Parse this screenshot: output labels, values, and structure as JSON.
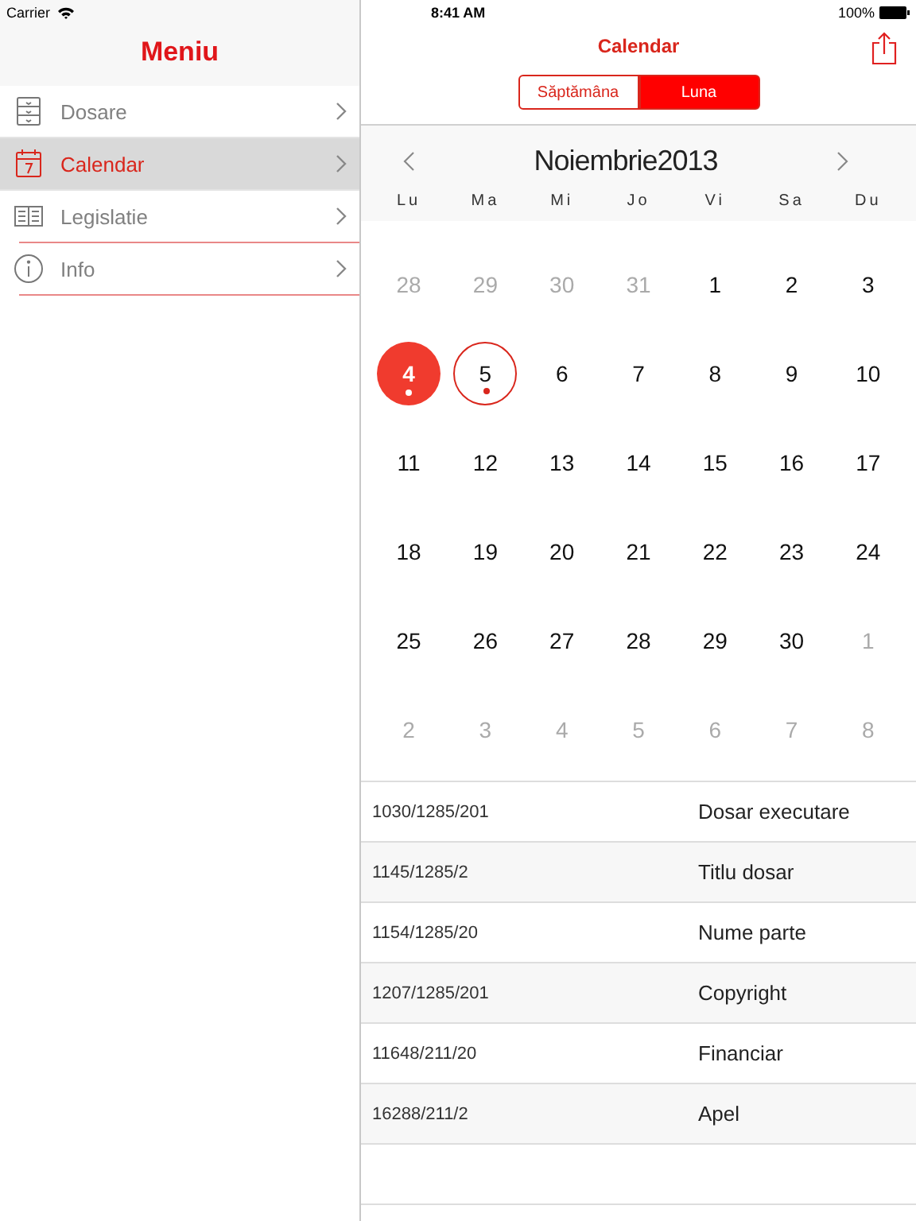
{
  "status_bar": {
    "carrier": "Carrier",
    "time": "8:41 AM",
    "battery": "100%"
  },
  "sidebar": {
    "title": "Meniu",
    "items": [
      {
        "kind": "drawers",
        "label": "Dosare",
        "selected": false,
        "underlined": false
      },
      {
        "kind": "calendar",
        "label": "Calendar",
        "selected": true,
        "underlined": false
      },
      {
        "kind": "book",
        "label": "Legislatie",
        "selected": false,
        "underlined": true
      },
      {
        "kind": "info",
        "label": "Info",
        "selected": false,
        "underlined": true
      }
    ]
  },
  "header": {
    "title": "Calendar",
    "segments": [
      {
        "label": "Săptămâna",
        "selected": false
      },
      {
        "label": "Luna",
        "selected": true
      }
    ]
  },
  "calendar": {
    "month": "Noiembrie",
    "year": "2013",
    "weekdays": [
      "Lu",
      "Ma",
      "Mi",
      "Jo",
      "Vi",
      "Sa",
      "Du"
    ],
    "weeks": [
      [
        {
          "day": "28",
          "in_month": false,
          "selected": false,
          "today": false,
          "event": false
        },
        {
          "day": "29",
          "in_month": false,
          "selected": false,
          "today": false,
          "event": false
        },
        {
          "day": "30",
          "in_month": false,
          "selected": false,
          "today": false,
          "event": false
        },
        {
          "day": "31",
          "in_month": false,
          "selected": false,
          "today": false,
          "event": false
        },
        {
          "day": "1",
          "in_month": true,
          "selected": false,
          "today": false,
          "event": false
        },
        {
          "day": "2",
          "in_month": true,
          "selected": false,
          "today": false,
          "event": false
        },
        {
          "day": "3",
          "in_month": true,
          "selected": false,
          "today": false,
          "event": false
        }
      ],
      [
        {
          "day": "4",
          "in_month": true,
          "selected": true,
          "today": false,
          "event": true
        },
        {
          "day": "5",
          "in_month": true,
          "selected": false,
          "today": true,
          "event": true
        },
        {
          "day": "6",
          "in_month": true,
          "selected": false,
          "today": false,
          "event": false
        },
        {
          "day": "7",
          "in_month": true,
          "selected": false,
          "today": false,
          "event": false
        },
        {
          "day": "8",
          "in_month": true,
          "selected": false,
          "today": false,
          "event": false
        },
        {
          "day": "9",
          "in_month": true,
          "selected": false,
          "today": false,
          "event": false
        },
        {
          "day": "10",
          "in_month": true,
          "selected": false,
          "today": false,
          "event": false
        }
      ],
      [
        {
          "day": "11",
          "in_month": true,
          "selected": false,
          "today": false,
          "event": false
        },
        {
          "day": "12",
          "in_month": true,
          "selected": false,
          "today": false,
          "event": false
        },
        {
          "day": "13",
          "in_month": true,
          "selected": false,
          "today": false,
          "event": false
        },
        {
          "day": "14",
          "in_month": true,
          "selected": false,
          "today": false,
          "event": false
        },
        {
          "day": "15",
          "in_month": true,
          "selected": false,
          "today": false,
          "event": false
        },
        {
          "day": "16",
          "in_month": true,
          "selected": false,
          "today": false,
          "event": false
        },
        {
          "day": "17",
          "in_month": true,
          "selected": false,
          "today": false,
          "event": false
        }
      ],
      [
        {
          "day": "18",
          "in_month": true,
          "selected": false,
          "today": false,
          "event": false
        },
        {
          "day": "19",
          "in_month": true,
          "selected": false,
          "today": false,
          "event": false
        },
        {
          "day": "20",
          "in_month": true,
          "selected": false,
          "today": false,
          "event": false
        },
        {
          "day": "21",
          "in_month": true,
          "selected": false,
          "today": false,
          "event": false
        },
        {
          "day": "22",
          "in_month": true,
          "selected": false,
          "today": false,
          "event": false
        },
        {
          "day": "23",
          "in_month": true,
          "selected": false,
          "today": false,
          "event": false
        },
        {
          "day": "24",
          "in_month": true,
          "selected": false,
          "today": false,
          "event": false
        }
      ],
      [
        {
          "day": "25",
          "in_month": true,
          "selected": false,
          "today": false,
          "event": false
        },
        {
          "day": "26",
          "in_month": true,
          "selected": false,
          "today": false,
          "event": false
        },
        {
          "day": "27",
          "in_month": true,
          "selected": false,
          "today": false,
          "event": false
        },
        {
          "day": "28",
          "in_month": true,
          "selected": false,
          "today": false,
          "event": false
        },
        {
          "day": "29",
          "in_month": true,
          "selected": false,
          "today": false,
          "event": false
        },
        {
          "day": "30",
          "in_month": true,
          "selected": false,
          "today": false,
          "event": false
        },
        {
          "day": "1",
          "in_month": false,
          "selected": false,
          "today": false,
          "event": false
        }
      ],
      [
        {
          "day": "2",
          "in_month": false,
          "selected": false,
          "today": false,
          "event": false
        },
        {
          "day": "3",
          "in_month": false,
          "selected": false,
          "today": false,
          "event": false
        },
        {
          "day": "4",
          "in_month": false,
          "selected": false,
          "today": false,
          "event": false
        },
        {
          "day": "5",
          "in_month": false,
          "selected": false,
          "today": false,
          "event": false
        },
        {
          "day": "6",
          "in_month": false,
          "selected": false,
          "today": false,
          "event": false
        },
        {
          "day": "7",
          "in_month": false,
          "selected": false,
          "today": false,
          "event": false
        },
        {
          "day": "8",
          "in_month": false,
          "selected": false,
          "today": false,
          "event": false
        }
      ]
    ]
  },
  "events": [
    {
      "number": "1030/1285/201",
      "title": "Dosar executare"
    },
    {
      "number": "1145/1285/2",
      "title": "Titlu dosar"
    },
    {
      "number": "1154/1285/20",
      "title": "Nume parte"
    },
    {
      "number": "1207/1285/201",
      "title": "Copyright"
    },
    {
      "number": "11648/211/20",
      "title": "Financiar"
    },
    {
      "number": "16288/211/2",
      "title": "Apel"
    }
  ]
}
